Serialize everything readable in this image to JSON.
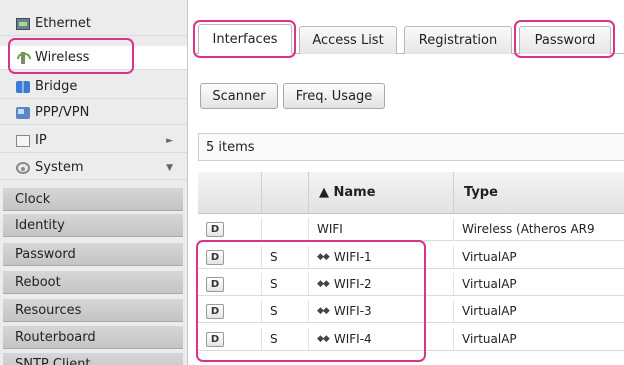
{
  "sidebar": {
    "items": [
      {
        "label": "Ethernet",
        "icon": "ethernet-icon"
      },
      {
        "label": "Wireless",
        "icon": "wireless-icon"
      },
      {
        "label": "Bridge",
        "icon": "bridge-icon"
      },
      {
        "label": "PPP/VPN",
        "icon": "ppp-vpn-icon"
      },
      {
        "label": "IP",
        "icon": "ip-icon",
        "arrow": "►"
      },
      {
        "label": "System",
        "icon": "system-gear-icon",
        "arrow": "▼"
      }
    ],
    "system_submenu": [
      "Clock",
      "Identity",
      "Password",
      "Reboot",
      "Resources",
      "Routerboard",
      "SNTP Client"
    ]
  },
  "tabs": [
    "Interfaces",
    "Access List",
    "Registration",
    "Password"
  ],
  "toolbar": {
    "scanner_label": "Scanner",
    "freq_usage_label": "Freq. Usage"
  },
  "status": {
    "item_count": "5 items"
  },
  "table": {
    "headers": [
      "",
      "",
      "▲ Name",
      "Type"
    ],
    "rows": [
      {
        "flag": "D",
        "status": "",
        "name": "WIFI",
        "type": "Wireless (Atheros AR9"
      },
      {
        "flag": "D",
        "status": "S",
        "name": "WIFI-1",
        "type": "VirtualAP"
      },
      {
        "flag": "D",
        "status": "S",
        "name": "WIFI-2",
        "type": "VirtualAP"
      },
      {
        "flag": "D",
        "status": "S",
        "name": "WIFI-3",
        "type": "VirtualAP"
      },
      {
        "flag": "D",
        "status": "S",
        "name": "WIFI-4",
        "type": "VirtualAP"
      }
    ]
  },
  "colors": {
    "highlight": "#d9338a",
    "sidebar_bg": "#ececec",
    "submenu_bg": "#cfcfcf"
  }
}
